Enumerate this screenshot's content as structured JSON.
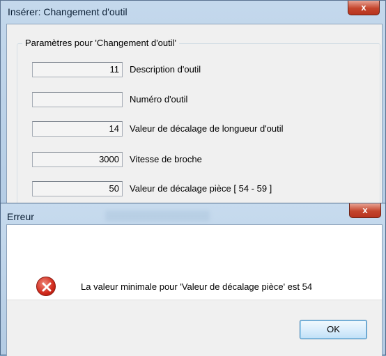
{
  "main_dialog": {
    "title": "Insérer: Changement d'outil",
    "close_glyph": "x",
    "group_label": "Paramètres pour 'Changement d'outil'",
    "fields": [
      {
        "value": "11",
        "label": "Description d'outil"
      },
      {
        "value": "",
        "label": "Numéro d'outil"
      },
      {
        "value": "14",
        "label": "Valeur de décalage de longueur d'outil"
      },
      {
        "value": "3000",
        "label": "Vitesse de broche"
      },
      {
        "value": "50",
        "label": "Valeur de décalage pièce  [ 54 - 59 ]"
      }
    ]
  },
  "error_dialog": {
    "title": "Erreur",
    "close_glyph": "x",
    "icon": "error-x-icon",
    "message": "La valeur minimale pour 'Valeur de décalage pièce' est 54",
    "ok_label": "OK"
  }
}
